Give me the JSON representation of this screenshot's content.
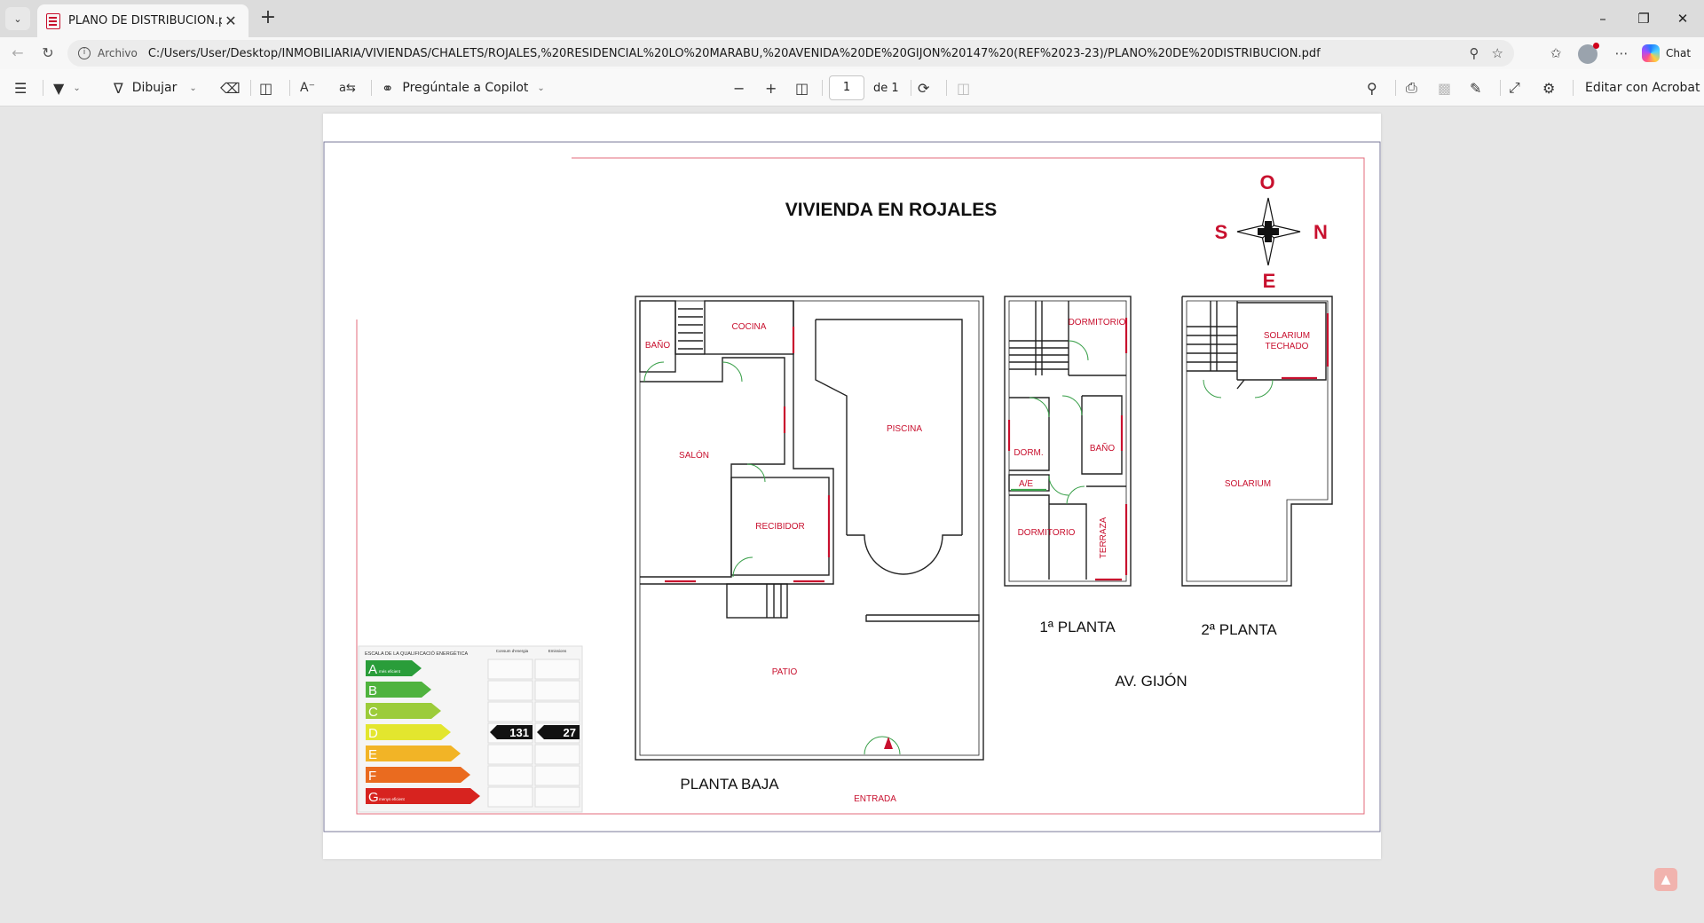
{
  "browser": {
    "tab_title": "PLANO DE DISTRIBUCION.pdf",
    "url_label": "Archivo",
    "url": "C:/Users/User/Desktop/INMOBILIARIA/VIVIENDAS/CHALETS/ROJALES,%20RESIDENCIAL%20LO%20MARABU,%20AVENIDA%20DE%20GIJON%20147%20(REF%2023-23)/PLANO%20DE%20DISTRIBUCION.pdf",
    "chat_label": "Chat"
  },
  "pdf_toolbar": {
    "draw_label": "Dibujar",
    "copilot_label": "Pregúntale a Copilot",
    "page_current": "1",
    "page_total": "de 1",
    "edit_label": "Editar con Acrobat"
  },
  "document": {
    "title": "VIVIENDA EN ROJALES",
    "compass": {
      "north": "N",
      "south": "S",
      "east": "E",
      "west": "O"
    },
    "rooms": {
      "bano": "BAÑO",
      "cocina": "COCINA",
      "salon": "SALÓN",
      "recibidor": "RECIBIDOR",
      "piscina": "PISCINA",
      "patio": "PATIO",
      "entrada": "ENTRADA",
      "dormitorio_1": "DORMITORIO",
      "dorm": "DORM.",
      "bano_1": "BAÑO",
      "ae": "A/E",
      "dormitorio_2": "DORMITORIO",
      "terraza": "TERRAZA",
      "solarium_techado_1": "SOLARIUM",
      "solarium_techado_2": "TECHADO",
      "solarium": "SOLARIUM"
    },
    "labels": {
      "planta_baja": "PLANTA BAJA",
      "planta_1": "1ª PLANTA",
      "planta_2": "2ª PLANTA",
      "street": "AV. GIJÓN"
    },
    "energy": {
      "header": "ESCALA DE LA QUALIFICACIÓ ENERGÈTICA",
      "col1": "Consum d'energia",
      "col2": "Emissions",
      "grades": [
        {
          "letter": "A",
          "note": "més eficient",
          "color": "#2a9d3a"
        },
        {
          "letter": "B",
          "note": "",
          "color": "#4fb33e"
        },
        {
          "letter": "C",
          "note": "",
          "color": "#9ccc3a"
        },
        {
          "letter": "D",
          "note": "",
          "color": "#e3e62e"
        },
        {
          "letter": "E",
          "note": "",
          "color": "#f2b426"
        },
        {
          "letter": "F",
          "note": "",
          "color": "#ea6b1f"
        },
        {
          "letter": "G",
          "note": "menys eficient",
          "color": "#d7231f"
        }
      ],
      "rating_grade": "D",
      "consumption_value": "131",
      "emissions_value": "27"
    }
  }
}
